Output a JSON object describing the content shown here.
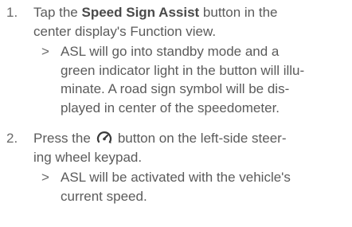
{
  "steps": [
    {
      "number": "1.",
      "text_prefix": "Tap the ",
      "text_bold": "Speed Sign Assist",
      "text_suffix_line1": " button in the",
      "text_line2": "center display's Function view.",
      "result_marker": ">",
      "result_lines": [
        "ASL will go into standby mode and a",
        "green indicator light in the button will illu-",
        "minate. A road sign symbol will be dis-",
        "played in center of the speedometer."
      ]
    },
    {
      "number": "2.",
      "text_prefix": "Press the",
      "icon": "speedometer-arrow-icon",
      "text_suffix_line1": "button on the left-side steer-",
      "text_line2": "ing wheel keypad.",
      "result_marker": ">",
      "result_lines": [
        "ASL will be activated with the vehicle's",
        "current speed."
      ]
    }
  ]
}
